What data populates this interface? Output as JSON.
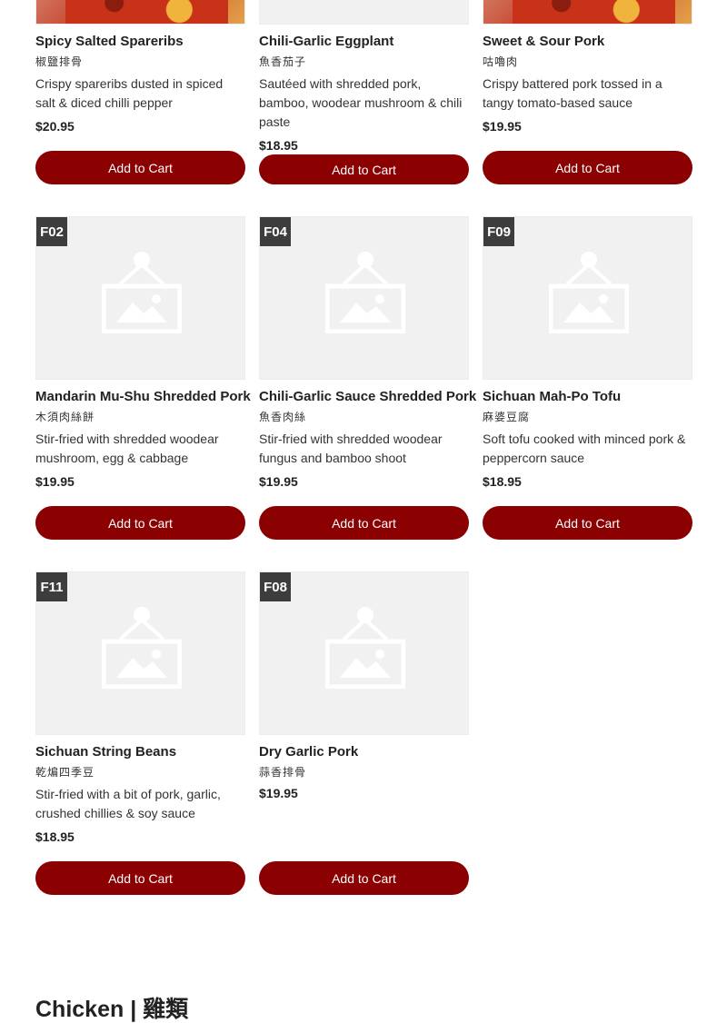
{
  "colors": {
    "button_bg": "#8b0000",
    "badge_bg": "#3d3d3d",
    "placeholder_bg": "#f1f1f1"
  },
  "items": [
    {
      "code": "",
      "photo": true,
      "name": "Spicy Salted Spareribs",
      "name_cn": "椒鹽排骨",
      "description": "Crispy spareribs dusted in spiced salt & diced chilli pepper",
      "price": "$20.95",
      "button": "Add to Cart"
    },
    {
      "code": "",
      "photo": false,
      "name": "Chili-Garlic Eggplant",
      "name_cn": "魚香茄子",
      "description": "Sautéed with shredded pork, bamboo, woodear mushroom & chili paste",
      "price": "$18.95",
      "button": "Add to Cart"
    },
    {
      "code": "",
      "photo": true,
      "name": "Sweet & Sour Pork",
      "name_cn": "咕嚕肉",
      "description": "Crispy battered pork tossed in a tangy tomato-based sauce",
      "price": "$19.95",
      "button": "Add to Cart"
    },
    {
      "code": "F02",
      "photo": false,
      "name": "Mandarin Mu-Shu Shredded Pork",
      "name_cn": "木須肉絲餅",
      "description": "Stir-fried with shredded woodear mushroom, egg & cabbage",
      "price": "$19.95",
      "button": "Add to Cart"
    },
    {
      "code": "F04",
      "photo": false,
      "name": "Chili-Garlic Sauce Shredded Pork",
      "name_cn": "魚香肉絲",
      "description": "Stir-fried with shredded woodear fungus and bamboo shoot",
      "price": "$19.95",
      "button": "Add to Cart"
    },
    {
      "code": "F09",
      "photo": false,
      "name": "Sichuan Mah-Po Tofu",
      "name_cn": "麻婆豆腐",
      "description": "Soft tofu cooked with minced pork & peppercorn sauce",
      "price": "$18.95",
      "button": "Add to Cart"
    },
    {
      "code": "F11",
      "photo": false,
      "name": "Sichuan String Beans",
      "name_cn": "乾煸四季豆",
      "description": "Stir-fried with a bit of pork, garlic, crushed chillies & soy sauce",
      "price": "$18.95",
      "button": "Add to Cart"
    },
    {
      "code": "F08",
      "photo": false,
      "name": "Dry Garlic Pork",
      "name_cn": "蒜香排骨",
      "description": "",
      "price": "$19.95",
      "button": "Add to Cart"
    }
  ],
  "next_section": {
    "title": "Chicken | 雞類"
  }
}
